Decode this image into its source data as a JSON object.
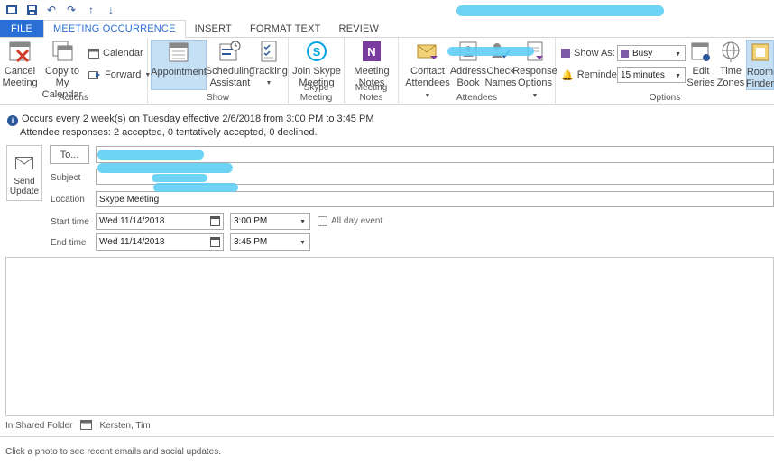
{
  "quick_access": [
    "outlook-icon",
    "save-icon",
    "undo-icon",
    "redo-icon",
    "up-arrow-icon",
    "down-arrow-icon"
  ],
  "tabs": [
    {
      "label": "FILE"
    },
    {
      "label": "MEETING OCCURRENCE"
    },
    {
      "label": "INSERT"
    },
    {
      "label": "FORMAT TEXT"
    },
    {
      "label": "REVIEW"
    }
  ],
  "ribbon": {
    "actions": {
      "label": "Actions",
      "cancel_line1": "Cancel",
      "cancel_line2": "Meeting",
      "copy_line1": "Copy to My",
      "copy_line2": "Calendar",
      "calendar": "Calendar",
      "forward": "Forward"
    },
    "show": {
      "label": "Show",
      "appointment": "Appointment",
      "sched_line1": "Scheduling",
      "sched_line2": "Assistant",
      "tracking": "Tracking"
    },
    "skype": {
      "label": "Skype Meeting",
      "line1": "Join Skype",
      "line2": "Meeting"
    },
    "notes": {
      "label": "Meeting Notes",
      "line1": "Meeting",
      "line2": "Notes"
    },
    "attendees": {
      "label": "Attendees",
      "contact_line1": "Contact",
      "contact_line2": "Attendees",
      "address_line1": "Address",
      "address_line2": "Book",
      "check_line1": "Check",
      "check_line2": "Names",
      "response_line1": "Response",
      "response_line2": "Options"
    },
    "options": {
      "label": "Options",
      "show_as_label": "Show As:",
      "show_as_value": "Busy",
      "reminder_label": "Reminder:",
      "reminder_value": "15 minutes",
      "edit_line1": "Edit",
      "edit_line2": "Series",
      "tz_line1": "Time",
      "tz_line2": "Zones",
      "room_line1": "Room",
      "room_line2": "Finder"
    }
  },
  "info": {
    "line1": "Occurs every 2 week(s) on Tuesday effective 2/6/2018 from 3:00 PM to 3:45 PM",
    "line2": "Attendee responses: 2 accepted, 0 tentatively accepted, 0 declined."
  },
  "form": {
    "send_line1": "Send",
    "send_line2": "Update",
    "to_label": "To...",
    "subject_label": "Subject",
    "location_label": "Location",
    "location_value": "Skype Meeting",
    "start_label": "Start time",
    "start_date": "Wed 11/14/2018",
    "start_time": "3:00 PM",
    "all_day": "All day event",
    "end_label": "End time",
    "end_date": "Wed 11/14/2018",
    "end_time": "3:45 PM"
  },
  "folder": {
    "label": "In Shared Folder",
    "owner": "Kersten, Tim"
  },
  "footer": "Click a photo to see recent emails and social updates.",
  "colors": {
    "accent": "#2a6fd6",
    "selected": "#c5dff5",
    "redaction": "#5ecef3"
  }
}
